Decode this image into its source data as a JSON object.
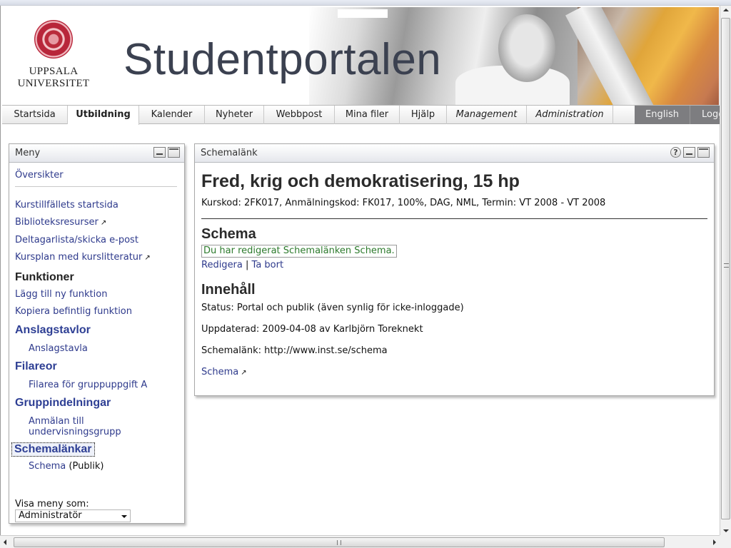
{
  "header": {
    "university_line1": "UPPSALA",
    "university_line2": "UNIVERSITET",
    "site_title": "Studentportalen"
  },
  "nav": {
    "items": [
      {
        "label": "Startsida",
        "active": false,
        "italic": false
      },
      {
        "label": "Utbildning",
        "active": true,
        "italic": false
      },
      {
        "label": "Kalender",
        "active": false,
        "italic": false
      },
      {
        "label": "Nyheter",
        "active": false,
        "italic": false
      },
      {
        "label": "Webbpost",
        "active": false,
        "italic": false
      },
      {
        "label": "Mina filer",
        "active": false,
        "italic": false
      },
      {
        "label": "Hjälp",
        "active": false,
        "italic": false
      },
      {
        "label": "Management",
        "active": false,
        "italic": true
      },
      {
        "label": "Administration",
        "active": false,
        "italic": true
      }
    ],
    "language": "English",
    "logout": "Logga ut"
  },
  "menu": {
    "title": "Meny",
    "overview": "Översikter",
    "links": [
      {
        "label": "Kurstillfällets startsida",
        "external": false
      },
      {
        "label": "Biblioteksresurser",
        "external": true
      },
      {
        "label": "Deltagarlista/skicka e-post",
        "external": false
      },
      {
        "label": "Kursplan med kurslitteratur",
        "external": true
      }
    ],
    "functions_heading": "Funktioner",
    "function_links": [
      "Lägg till ny funktion",
      "Kopiera befintlig funktion"
    ],
    "sections": [
      {
        "heading": "Anslagstavlor",
        "items": [
          "Anslagstavla"
        ]
      },
      {
        "heading": "Filareor",
        "items": [
          "Filarea för gruppuppgift A"
        ]
      },
      {
        "heading": "Gruppindelningar",
        "items": [
          "Anmälan till undervisningsgrupp"
        ]
      },
      {
        "heading": "Schemalänkar",
        "items": [
          "Schema"
        ],
        "item_suffix": "(Publik)",
        "focused": true
      }
    ],
    "view_as_label": "Visa meny som:",
    "view_as_value": "Administratör"
  },
  "content": {
    "panel_title": "Schemalänk",
    "course_title": "Fred, krig och demokratisering, 15 hp",
    "course_info": "Kurskod: 2FK017, Anmälningskod: FK017, 100%, DAG, NML, Termin: VT 2008 - VT 2008",
    "schema_heading": "Schema",
    "notice": "Du har redigerat Schemalänken Schema.",
    "edit_label": "Redigera",
    "separator": "|",
    "delete_label": "Ta bort",
    "content_heading": "Innehåll",
    "status": "Status: Portal och publik (även synlig för icke-inloggade)",
    "updated": "Uppdaterad: 2009-04-08 av Karlbjörn Toreknekt",
    "schema_link_text": "Schemalänk: http://www.inst.se/schema",
    "schema_link_label": "Schema"
  },
  "icons": {
    "external": "↗",
    "help": "?"
  },
  "colors": {
    "link": "#2e3a8c",
    "heading_blue": "#2e3f94",
    "notice_green": "#2c7a2c",
    "seal_red": "#b8263a"
  }
}
